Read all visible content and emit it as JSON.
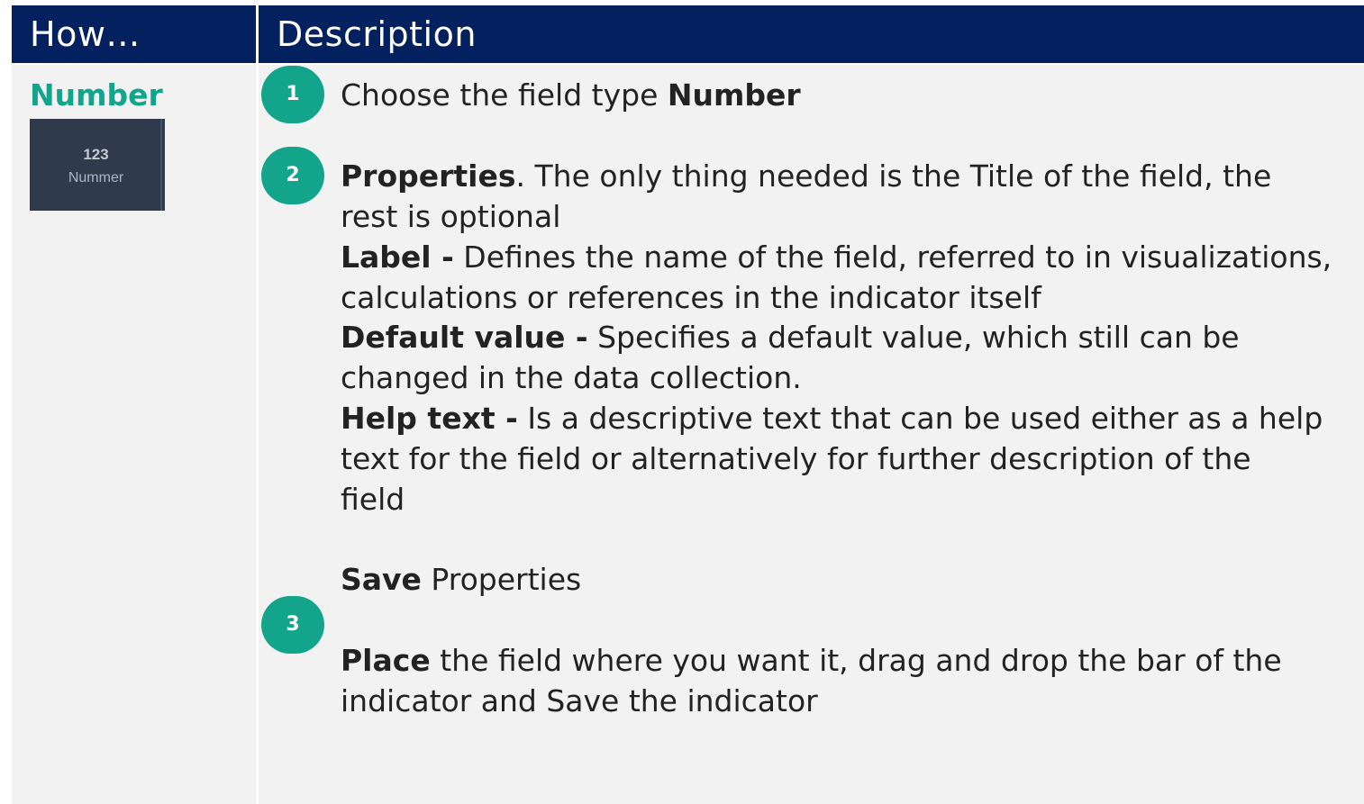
{
  "header": {
    "col1": "How…",
    "col2": "Description"
  },
  "left": {
    "field_type": "Number",
    "widget": {
      "number": "123",
      "label": "Nummer"
    }
  },
  "steps": [
    {
      "number": "1"
    },
    {
      "number": "2"
    },
    {
      "number": "3"
    }
  ],
  "description": {
    "step1": {
      "text": "Choose the field type ",
      "bold": "Number"
    },
    "step2": {
      "properties_bold": "Properties",
      "properties_line1": ". The only thing needed is the Title of the field, the",
      "properties_line2": "rest is optional",
      "label_bold": "Label -",
      "label_line1": " Defines the name of the field, referred to in visualizations,",
      "label_line2": "calculations or references in the indicator itself",
      "default_bold": "Default value -",
      "default_line1": " Specifies a default value, which still can be",
      "default_line2": "changed in the data collection.",
      "help_bold": "Help text -",
      "help_line1": " Is a descriptive text that can be used either as a help",
      "help_line2": "text for the field or alternatively for further description of the",
      "help_line3": "field"
    },
    "step3": {
      "save_bold": "Save",
      "save_text": " Properties",
      "place_bold": "Place",
      "place_line1": " the field where you want it, drag and drop the bar of the",
      "place_line2": "indicator and Save the indicator"
    }
  },
  "colors": {
    "header_bg": "#03215f",
    "accent": "#13a58c",
    "row_bg": "#f2f2f2",
    "widget_bg": "#2f3a4a"
  }
}
